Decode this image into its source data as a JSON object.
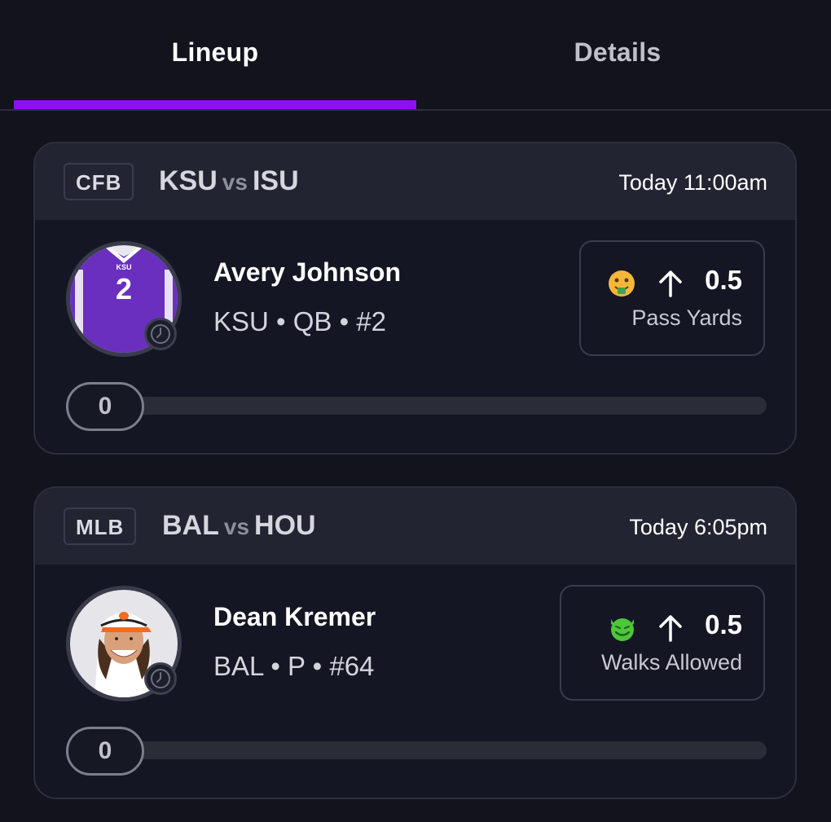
{
  "tabs": [
    {
      "label": "Lineup",
      "active": true
    },
    {
      "label": "Details",
      "active": false
    }
  ],
  "colors": {
    "accent": "#8a12f1",
    "background": "#12131d"
  },
  "picks": [
    {
      "league": "CFB",
      "home": "KSU",
      "vs": "vs",
      "away": "ISU",
      "time": "Today 11:00am",
      "player": {
        "name": "Avery Johnson",
        "info": "KSU • QB • #2",
        "jersey_text": "KSU",
        "jersey_number": "2"
      },
      "prop": {
        "emoji": "money-mouth-face-icon",
        "direction": "up-arrow-icon",
        "line": "0.5",
        "stat": "Pass Yards"
      },
      "progress": {
        "value": "0"
      }
    },
    {
      "league": "MLB",
      "home": "BAL",
      "vs": "vs",
      "away": "HOU",
      "time": "Today 6:05pm",
      "player": {
        "name": "Dean Kremer",
        "info": "BAL • P • #64"
      },
      "prop": {
        "emoji": "smiling-devil-face-icon",
        "direction": "up-arrow-icon",
        "line": "0.5",
        "stat": "Walks Allowed"
      },
      "progress": {
        "value": "0"
      }
    }
  ]
}
